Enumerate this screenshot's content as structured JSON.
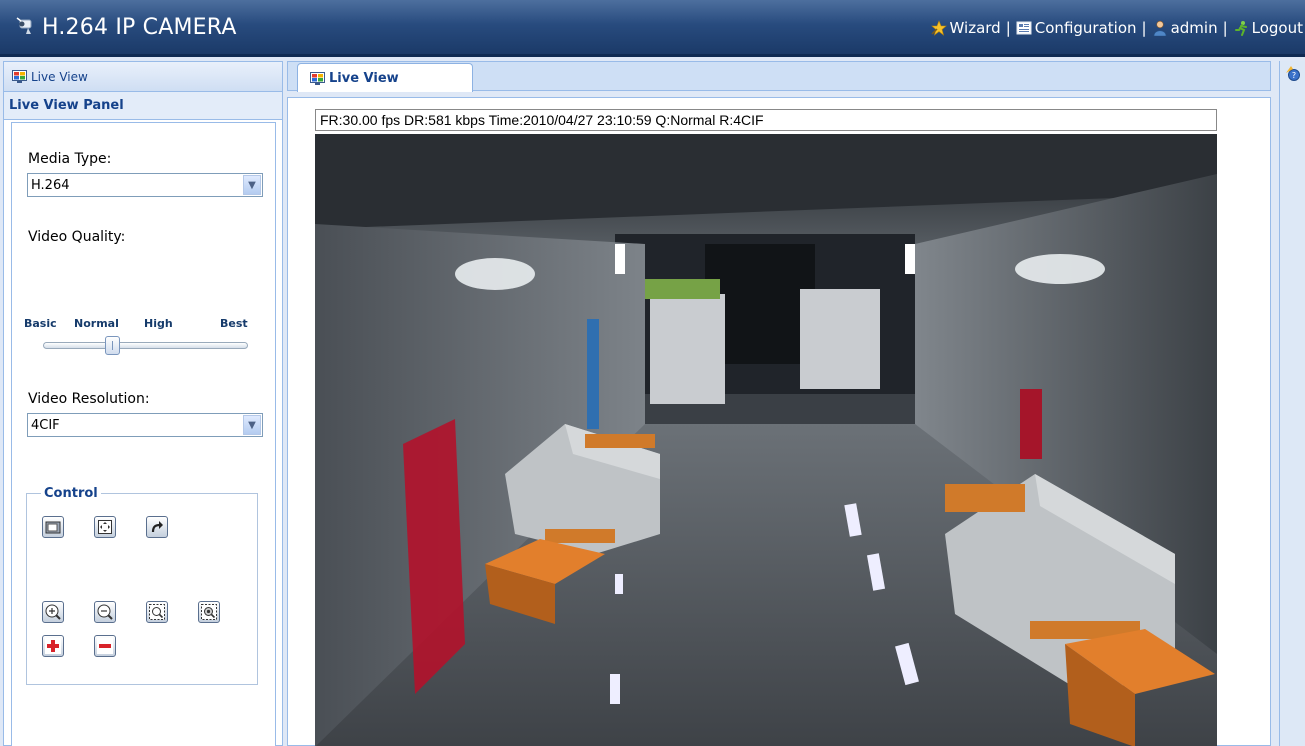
{
  "app": {
    "title": "H.264 IP CAMERA"
  },
  "topnav": {
    "items": [
      {
        "label": "Wizard",
        "icon": "wizard-star-icon"
      },
      {
        "label": "Configuration",
        "icon": "configuration-icon"
      },
      {
        "label": "admin",
        "icon": "user-icon"
      },
      {
        "label": "Logout",
        "icon": "logout-icon"
      }
    ],
    "separator": "|"
  },
  "left_panel": {
    "title": "Live View",
    "subheader": "Live View Panel",
    "media_type": {
      "label": "Media Type:",
      "value": "H.264"
    },
    "video_quality": {
      "label": "Video Quality:",
      "levels": [
        "Basic",
        "Normal",
        "High",
        "Best"
      ],
      "selected": "Normal"
    },
    "video_resolution": {
      "label": "Video Resolution:",
      "value": "4CIF"
    },
    "control": {
      "label": "Control",
      "buttons_row1": [
        "snapshot-icon",
        "fullscreen-icon",
        "redo-icon"
      ],
      "buttons_row2": [
        "zoom-in-icon",
        "zoom-out-icon",
        "focus-near-icon",
        "focus-far-icon"
      ],
      "buttons_row3": [
        "plus-icon",
        "minus-icon"
      ]
    }
  },
  "main": {
    "tab_label": "Live View",
    "status_text": "FR:30.00 fps  DR:581 kbps Time:2010/04/27 23:10:59 Q:Normal R:4CIF"
  },
  "colors": {
    "header_bg": "#284b7e",
    "panel_border": "#99bbe8",
    "title_text": "#15428b"
  }
}
